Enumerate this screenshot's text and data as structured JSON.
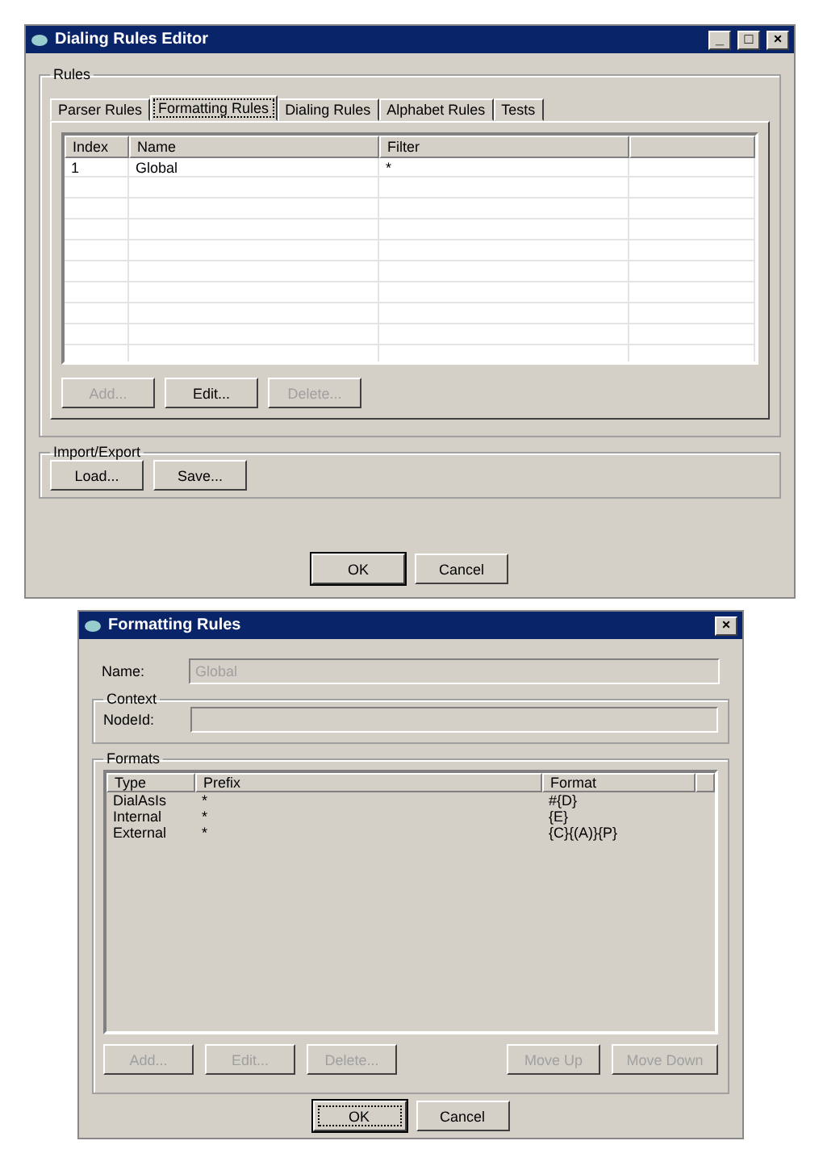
{
  "editor": {
    "title": "Dialing Rules Editor",
    "window_buttons": [
      "_",
      "□",
      "×"
    ],
    "rules_group": {
      "label": "Rules",
      "tabs": [
        {
          "label": "Parser Rules",
          "selected": false
        },
        {
          "label": "Formatting Rules",
          "selected": true
        },
        {
          "label": "Dialing Rules",
          "selected": false
        },
        {
          "label": "Alphabet Rules",
          "selected": false
        },
        {
          "label": "Tests",
          "selected": false
        }
      ],
      "table": {
        "columns": [
          "Index",
          "Name",
          "Filter"
        ],
        "rows": [
          [
            "1",
            "Global",
            "*"
          ]
        ]
      },
      "buttons": [
        {
          "label": "Add...",
          "disabled": true
        },
        {
          "label": "Edit...",
          "disabled": false
        },
        {
          "label": "Delete...",
          "disabled": true
        }
      ]
    },
    "import_export": {
      "label": "Import/Export",
      "buttons": [
        "Load...",
        "Save..."
      ]
    },
    "footer": [
      {
        "label": "OK",
        "default": true
      },
      {
        "label": "Cancel",
        "default": false
      }
    ]
  },
  "formatting": {
    "title": "Formatting Rules",
    "close": "×",
    "name": {
      "label": "Name:",
      "value": "Global",
      "disabled": true
    },
    "context": {
      "label": "Context",
      "field_label": "NodeId:"
    },
    "formats": {
      "label": "Formats",
      "columns": [
        "Type",
        "Prefix",
        "Format"
      ],
      "rows": [
        [
          "DialAsIs",
          "*",
          "#{D}"
        ],
        [
          "Internal",
          "*",
          "{E}"
        ],
        [
          "External",
          "*",
          "{C}{(A)}{P}"
        ]
      ],
      "buttons": [
        {
          "label": "Add...",
          "disabled": true
        },
        {
          "label": "Edit...",
          "disabled": true
        },
        {
          "label": "Delete...",
          "disabled": true
        },
        {
          "label": "Move Up",
          "disabled": true
        },
        {
          "label": "Move Down",
          "disabled": true
        }
      ]
    },
    "footer": [
      {
        "label": "OK",
        "focused": true
      },
      {
        "label": "Cancel",
        "focused": false
      }
    ]
  }
}
